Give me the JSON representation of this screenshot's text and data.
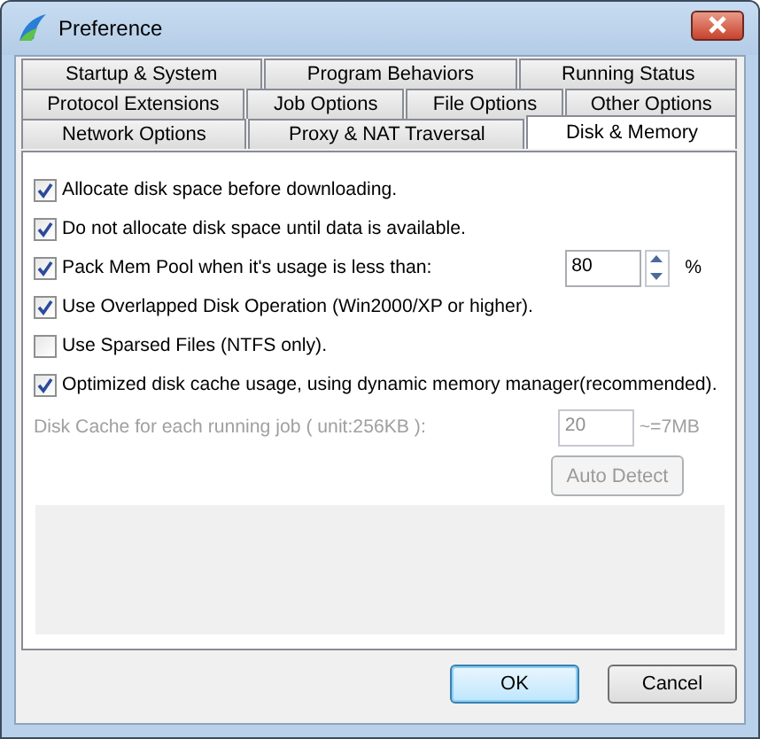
{
  "window": {
    "title": "Preference"
  },
  "tab_rows": [
    [
      {
        "label": "Startup & System",
        "selected": false
      },
      {
        "label": "Program Behaviors",
        "selected": false
      },
      {
        "label": "Running Status",
        "selected": false
      }
    ],
    [
      {
        "label": "Protocol Extensions",
        "selected": false
      },
      {
        "label": "Job Options",
        "selected": false
      },
      {
        "label": "File Options",
        "selected": false
      },
      {
        "label": "Other Options",
        "selected": false
      }
    ],
    [
      {
        "label": "Network Options",
        "selected": false
      },
      {
        "label": "Proxy & NAT Traversal",
        "selected": false
      },
      {
        "label": "Disk & Memory",
        "selected": true
      }
    ]
  ],
  "options": [
    {
      "kind": "checkbox",
      "label": "Allocate disk space before downloading.",
      "checked": true
    },
    {
      "kind": "checkbox",
      "label": "Do not allocate disk space until data is available.",
      "checked": true
    },
    {
      "kind": "spin",
      "label": "Pack Mem Pool when it's usage is less than:",
      "checked": true,
      "value": "80",
      "unit": "%"
    },
    {
      "kind": "checkbox",
      "label": "Use Overlapped Disk Operation (Win2000/XP or higher).",
      "checked": true
    },
    {
      "kind": "checkbox",
      "label": "Use Sparsed Files (NTFS only).",
      "checked": false
    },
    {
      "kind": "checkbox",
      "label": "Optimized disk cache usage, using dynamic memory manager(recommended).",
      "checked": true
    },
    {
      "kind": "field",
      "label": "Disk Cache for each running job ( unit:256KB ):",
      "disabled": true,
      "value": "20",
      "unit": "~=7MB"
    }
  ],
  "auto_detect": {
    "label": "Auto Detect",
    "disabled": true
  },
  "buttons": [
    {
      "label": "OK",
      "default": true
    },
    {
      "label": "Cancel",
      "default": false
    }
  ]
}
